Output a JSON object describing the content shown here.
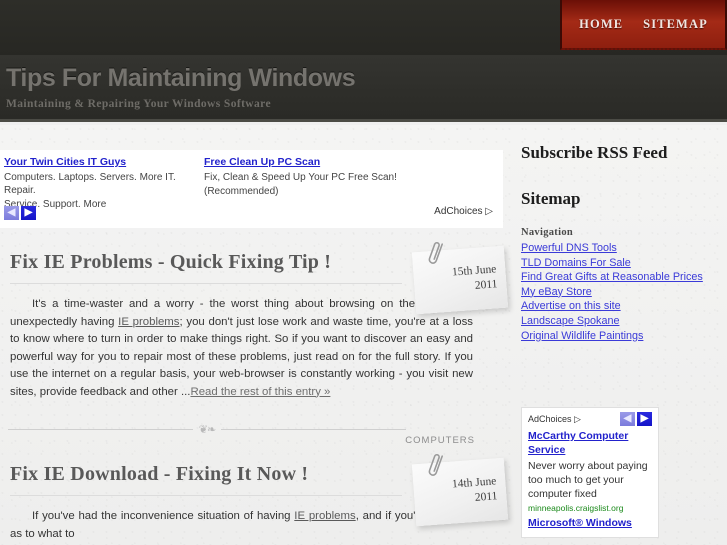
{
  "nav": {
    "items": [
      {
        "label": "HOME"
      },
      {
        "label": "SITEMAP"
      }
    ]
  },
  "header": {
    "site_title": "Tips For Maintaining Windows",
    "tagline": "Maintaining &  Repairing Your Windows Software",
    "accent_color": "#a42a16",
    "band_color": "#2b2b26"
  },
  "top_ad": {
    "left": {
      "title": "Your Twin Cities IT Guys",
      "line1": "Computers. Laptops. Servers. More IT. Repair.",
      "line2": "Service. Support. More"
    },
    "right": {
      "title": "Free Clean Up PC Scan",
      "line1": "Fix, Clean & Speed Up Your PC Free Scan!",
      "line2": "(Recommended)"
    },
    "prev_icon": "chevron-left-icon",
    "next_icon": "chevron-right-icon",
    "adchoices_label": "AdChoices"
  },
  "articles": [
    {
      "title": "Fix IE Problems - Quick Fixing Tip !",
      "date_day": "15th June",
      "date_year": "2011",
      "body_lead": "It's a time-waster and a worry - the worst thing about browsing on the internet is unexpectedly having ",
      "body_link": "IE problems",
      "body_rest": "; you don't just lose work and waste time, you're at a loss to know where to turn in order to make things right. So if you want to discover an easy and powerful way for you to repair most of these problems, just read on for the full story. If you use the internet on a regular basis, your web-browser is constantly working - you visit new sites, provide feedback and other ...",
      "more_label": "Read the rest of this entry »",
      "category": "COMPUTERS"
    },
    {
      "title": "Fix IE Download - Fixing It Now !",
      "date_day": "14th June",
      "date_year": "2011",
      "body_lead": "If you've had the inconvenience situation of having ",
      "body_link": "IE problems",
      "body_rest": ", and if you're at a loss as to what to",
      "more_label": "",
      "category": ""
    }
  ],
  "sidebar": {
    "rss_heading": "Subscribe RSS Feed",
    "sitemap_heading": "Sitemap",
    "nav_label": "Navigation",
    "nav_links": [
      {
        "label": "Powerful DNS Tools"
      },
      {
        "label": "TLD Domains For Sale"
      },
      {
        "label": "Find Great Gifts at Reasonable Prices"
      },
      {
        "label": "My eBay Store"
      },
      {
        "label": "Advertise on this site"
      },
      {
        "label": "Landscape Spokane"
      },
      {
        "label": "Original Wildlife Paintings"
      }
    ],
    "ad": {
      "adchoices_label": "AdChoices",
      "prev_icon": "chevron-left-icon",
      "next_icon": "chevron-right-icon",
      "item1_title": "McCarthy Computer Service",
      "item1_text": "Never worry about paying too much to get your computer fixed",
      "item1_url": "minneapolis.craigslist.org",
      "item2_title": "Microsoft® Windows"
    }
  }
}
